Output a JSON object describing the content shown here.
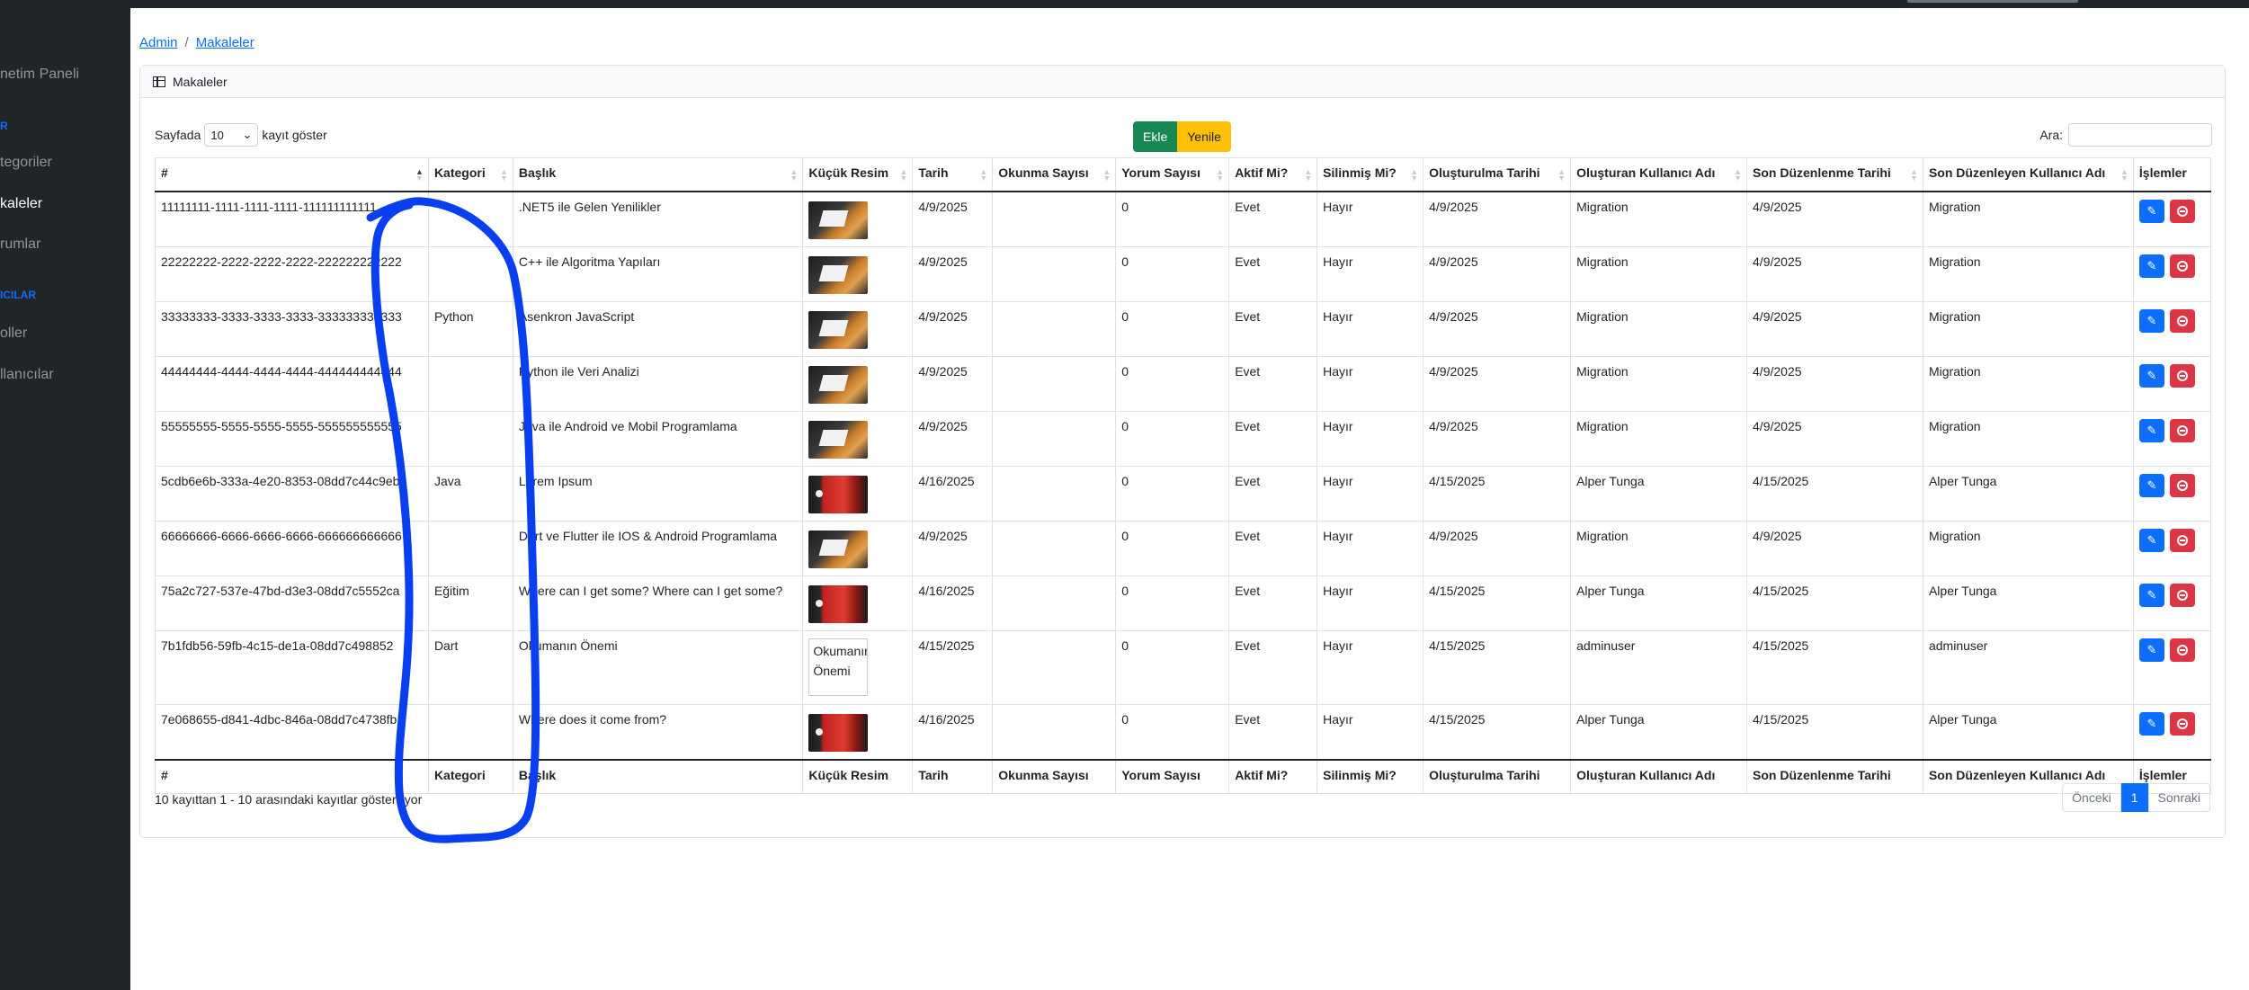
{
  "sidebar": {
    "items": [
      {
        "label": "netim Paneli"
      },
      {
        "label": "tegoriler"
      },
      {
        "label": "kaleler"
      },
      {
        "label": "rumlar"
      },
      {
        "label": "oller"
      },
      {
        "label": "llanıcılar"
      }
    ],
    "headings": [
      {
        "label": "R"
      },
      {
        "label": "ICILAR"
      }
    ]
  },
  "breadcrumb": {
    "root": "Admin",
    "current": "Makaleler"
  },
  "card": {
    "title": "Makaleler"
  },
  "controls": {
    "length_prefix": "Sayfada",
    "length_value": "10",
    "length_suffix": "kayıt göster",
    "add_label": "Ekle",
    "refresh_label": "Yenile",
    "search_label": "Ara:"
  },
  "table": {
    "headers": [
      "#",
      "Kategori",
      "Başlık",
      "Küçük Resim",
      "Tarih",
      "Okunma Sayısı",
      "Yorum Sayısı",
      "Aktif Mi?",
      "Silinmiş Mi?",
      "Oluşturulma Tarihi",
      "Oluşturan Kullanıcı Adı",
      "Son Düzenlenme Tarihi",
      "Son Düzenleyen Kullanıcı Adı",
      "İşlemler"
    ],
    "rows": [
      {
        "id": "11111111-1111-1111-1111-111111111111",
        "category": "",
        "title": ".NET5 ile Gelen Yenilikler",
        "thumb": "a",
        "date": "4/9/2025",
        "views": "",
        "comments": "0",
        "active": "Evet",
        "deleted": "Hayır",
        "created": "4/9/2025",
        "created_by": "Migration",
        "modified": "4/9/2025",
        "modified_by": "Migration"
      },
      {
        "id": "22222222-2222-2222-2222-222222222222",
        "category": "",
        "title": "C++ ile Algoritma Yapıları",
        "thumb": "a",
        "date": "4/9/2025",
        "views": "",
        "comments": "0",
        "active": "Evet",
        "deleted": "Hayır",
        "created": "4/9/2025",
        "created_by": "Migration",
        "modified": "4/9/2025",
        "modified_by": "Migration"
      },
      {
        "id": "33333333-3333-3333-3333-333333333333",
        "category": "Python",
        "title": "Asenkron JavaScript",
        "thumb": "a",
        "date": "4/9/2025",
        "views": "",
        "comments": "0",
        "active": "Evet",
        "deleted": "Hayır",
        "created": "4/9/2025",
        "created_by": "Migration",
        "modified": "4/9/2025",
        "modified_by": "Migration"
      },
      {
        "id": "44444444-4444-4444-4444-444444444444",
        "category": "",
        "title": "Python ile Veri Analizi",
        "thumb": "a",
        "date": "4/9/2025",
        "views": "",
        "comments": "0",
        "active": "Evet",
        "deleted": "Hayır",
        "created": "4/9/2025",
        "created_by": "Migration",
        "modified": "4/9/2025",
        "modified_by": "Migration"
      },
      {
        "id": "55555555-5555-5555-5555-555555555555",
        "category": "",
        "title": "Java ile Android ve Mobil Programlama",
        "thumb": "a",
        "date": "4/9/2025",
        "views": "",
        "comments": "0",
        "active": "Evet",
        "deleted": "Hayır",
        "created": "4/9/2025",
        "created_by": "Migration",
        "modified": "4/9/2025",
        "modified_by": "Migration"
      },
      {
        "id": "5cdb6e6b-333a-4e20-8353-08dd7c44c9eb",
        "category": "Java",
        "title": "Lorem Ipsum",
        "thumb": "b",
        "date": "4/16/2025",
        "views": "",
        "comments": "0",
        "active": "Evet",
        "deleted": "Hayır",
        "created": "4/15/2025",
        "created_by": "Alper Tunga",
        "modified": "4/15/2025",
        "modified_by": "Alper Tunga"
      },
      {
        "id": "66666666-6666-6666-6666-666666666666",
        "category": "",
        "title": "Dart ve Flutter ile IOS & Android Programlama",
        "thumb": "a",
        "date": "4/9/2025",
        "views": "",
        "comments": "0",
        "active": "Evet",
        "deleted": "Hayır",
        "created": "4/9/2025",
        "created_by": "Migration",
        "modified": "4/9/2025",
        "modified_by": "Migration"
      },
      {
        "id": "75a2c727-537e-47bd-d3e3-08dd7c5552ca",
        "category": "Eğitim",
        "title": "Where can I get some? Where can I get some?",
        "thumb": "b",
        "date": "4/16/2025",
        "views": "",
        "comments": "0",
        "active": "Evet",
        "deleted": "Hayır",
        "created": "4/15/2025",
        "created_by": "Alper Tunga",
        "modified": "4/15/2025",
        "modified_by": "Alper Tunga"
      },
      {
        "id": "7b1fdb56-59fb-4c15-de1a-08dd7c498852",
        "category": "Dart",
        "title": "Okumanın Önemi",
        "thumb": "broken",
        "thumb_alt": "Okumanın Önemi",
        "date": "4/15/2025",
        "views": "",
        "comments": "0",
        "active": "Evet",
        "deleted": "Hayır",
        "created": "4/15/2025",
        "created_by": "adminuser",
        "modified": "4/15/2025",
        "modified_by": "adminuser"
      },
      {
        "id": "7e068655-d841-4dbc-846a-08dd7c4738fb",
        "category": "",
        "title": "Where does it come from?",
        "thumb": "b",
        "date": "4/16/2025",
        "views": "",
        "comments": "0",
        "active": "Evet",
        "deleted": "Hayır",
        "created": "4/15/2025",
        "created_by": "Alper Tunga",
        "modified": "4/15/2025",
        "modified_by": "Alper Tunga"
      }
    ]
  },
  "footer": {
    "info": "10 kayıttan 1 - 10 arasındaki kayıtlar gösteriliyor",
    "prev": "Önceki",
    "page": "1",
    "next": "Sonraki"
  },
  "colors": {
    "sidebar_bg": "#212529",
    "primary": "#0d6efd",
    "success": "#198754",
    "warning": "#ffc107",
    "danger": "#dc3545",
    "annotation_stroke": "#0a3ff0"
  }
}
